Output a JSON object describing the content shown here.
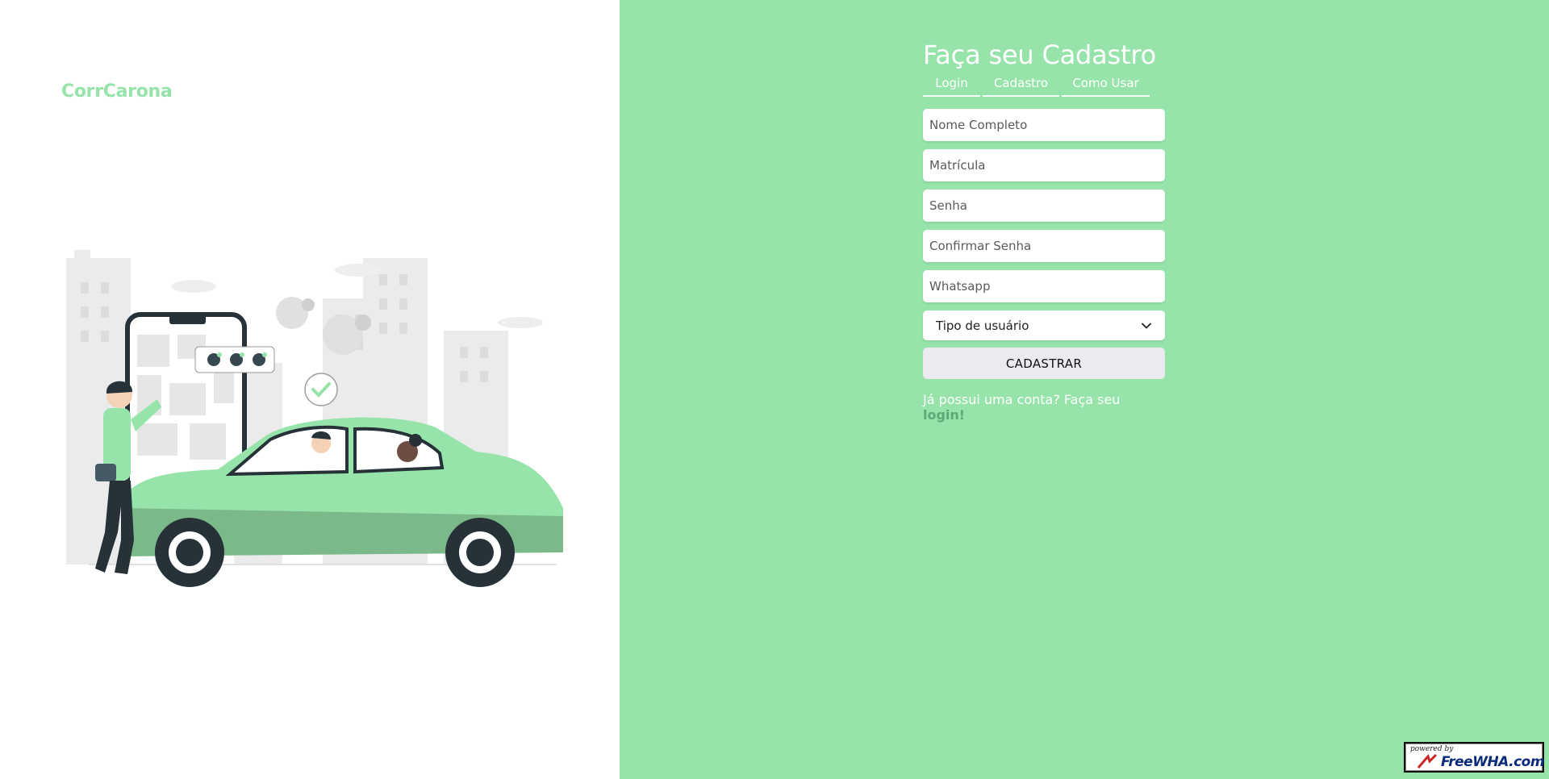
{
  "brand": {
    "name": "CorrCarona"
  },
  "form": {
    "title": "Faça seu Cadastro",
    "tabs": [
      {
        "label": "Login"
      },
      {
        "label": "Cadastro"
      },
      {
        "label": "Como Usar"
      }
    ],
    "fields": {
      "name_placeholder": "Nome Completo",
      "registration_placeholder": "Matrícula",
      "password_placeholder": "Senha",
      "confirm_password_placeholder": "Confirmar Senha",
      "whatsapp_placeholder": "Whatsapp"
    },
    "user_type": {
      "selected": "Tipo de usuário"
    },
    "submit_label": "CADASTRAR",
    "login_prompt": {
      "text": "Já possui uma conta? Faça seu ",
      "link": "login!"
    }
  },
  "badge": {
    "top": "powered by",
    "brand": "FreeWHA.com"
  },
  "colors": {
    "accent": "#96e4a9",
    "link": "#5ea877",
    "button": "#ebeaef"
  },
  "icons": [
    "chevron-down-icon",
    "checkmark-icon",
    "user-icon"
  ]
}
